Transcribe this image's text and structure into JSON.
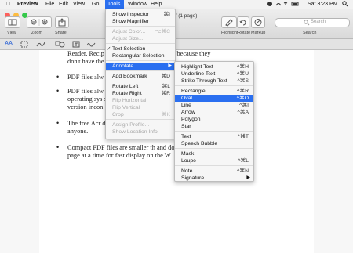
{
  "menubar": {
    "apple": "",
    "app": "Preview",
    "items": [
      "File",
      "Edit",
      "View",
      "Go",
      "Tools",
      "Window",
      "Help"
    ],
    "clock": "Sat 3:23 PM"
  },
  "toolbar": {
    "title": "df (1 page)",
    "labels": {
      "view": "View",
      "zoom": "Zoom",
      "share": "Share",
      "highlight": "Highlight",
      "rotate": "Rotate",
      "markup": "Markup",
      "search": "Search"
    },
    "search_placeholder": "Search"
  },
  "markup": {
    "text_icon": "AA"
  },
  "document": {
    "lines": [
      {
        "t": "Reader. Recip          sometimes can't open files because they"
      },
      {
        "t": "don't have the               the documents."
      },
      {
        "t": "PDF files alw"
      },
      {
        "t": "PDF files alw                                 software, and"
      },
      {
        "t": "operating sys                                 software, and"
      },
      {
        "t": "version incon"
      },
      {
        "t": "The free Acr                                 distributed by"
      },
      {
        "t": "anyone."
      },
      {
        "t": "Compact PDF files are smaller th            and download a"
      },
      {
        "t": "page at a time for fast display on the W"
      }
    ]
  },
  "tools_menu": [
    {
      "label": "Show Inspector",
      "shortcut": "⌘I",
      "state": "normal"
    },
    {
      "label": "Show Magnifier",
      "shortcut": "",
      "state": "normal"
    },
    {
      "sep": true
    },
    {
      "label": "Adjust Color...",
      "shortcut": "⌥⌘C",
      "state": "disabled"
    },
    {
      "label": "Adjust Size...",
      "shortcut": "",
      "state": "disabled"
    },
    {
      "sep": true
    },
    {
      "label": "Text Selection",
      "shortcut": "",
      "state": "checked"
    },
    {
      "label": "Rectangular Selection",
      "shortcut": "",
      "state": "normal"
    },
    {
      "sep": true
    },
    {
      "label": "Annotate",
      "shortcut": "▶",
      "state": "selected"
    },
    {
      "sep": true
    },
    {
      "label": "Add Bookmark",
      "shortcut": "⌘D",
      "state": "normal"
    },
    {
      "sep": true
    },
    {
      "label": "Rotate Left",
      "shortcut": "⌘L",
      "state": "normal"
    },
    {
      "label": "Rotate Right",
      "shortcut": "⌘R",
      "state": "normal"
    },
    {
      "label": "Flip Horizontal",
      "shortcut": "",
      "state": "disabled"
    },
    {
      "label": "Flip Vertical",
      "shortcut": "",
      "state": "disabled"
    },
    {
      "label": "Crop",
      "shortcut": "⌘K",
      "state": "disabled"
    },
    {
      "sep": true
    },
    {
      "label": "Assign Profile...",
      "shortcut": "",
      "state": "disabled"
    },
    {
      "label": "Show Location Info",
      "shortcut": "",
      "state": "disabled"
    }
  ],
  "annotate_menu": [
    {
      "label": "Highlight Text",
      "shortcut": "^⌘H",
      "state": "normal"
    },
    {
      "label": "Underline Text",
      "shortcut": "^⌘U",
      "state": "normal"
    },
    {
      "label": "Strike Through Text",
      "shortcut": "^⌘S",
      "state": "normal"
    },
    {
      "sep": true
    },
    {
      "label": "Rectangle",
      "shortcut": "^⌘R",
      "state": "normal"
    },
    {
      "label": "Oval",
      "shortcut": "^⌘O",
      "state": "selected"
    },
    {
      "label": "Line",
      "shortcut": "^⌘I",
      "state": "normal"
    },
    {
      "label": "Arrow",
      "shortcut": "^⌘A",
      "state": "normal"
    },
    {
      "label": "Polygon",
      "shortcut": "",
      "state": "normal"
    },
    {
      "label": "Star",
      "shortcut": "",
      "state": "normal"
    },
    {
      "sep": true
    },
    {
      "label": "Text",
      "shortcut": "^⌘T",
      "state": "normal"
    },
    {
      "label": "Speech Bubble",
      "shortcut": "",
      "state": "normal"
    },
    {
      "sep": true
    },
    {
      "label": "Mask",
      "shortcut": "",
      "state": "normal"
    },
    {
      "label": "Loupe",
      "shortcut": "^⌘L",
      "state": "normal"
    },
    {
      "sep": true
    },
    {
      "label": "Note",
      "shortcut": "^⌘N",
      "state": "normal"
    },
    {
      "label": "Signature",
      "shortcut": "▶",
      "state": "normal"
    }
  ],
  "colors": {
    "accent": "#2a6ff0"
  }
}
